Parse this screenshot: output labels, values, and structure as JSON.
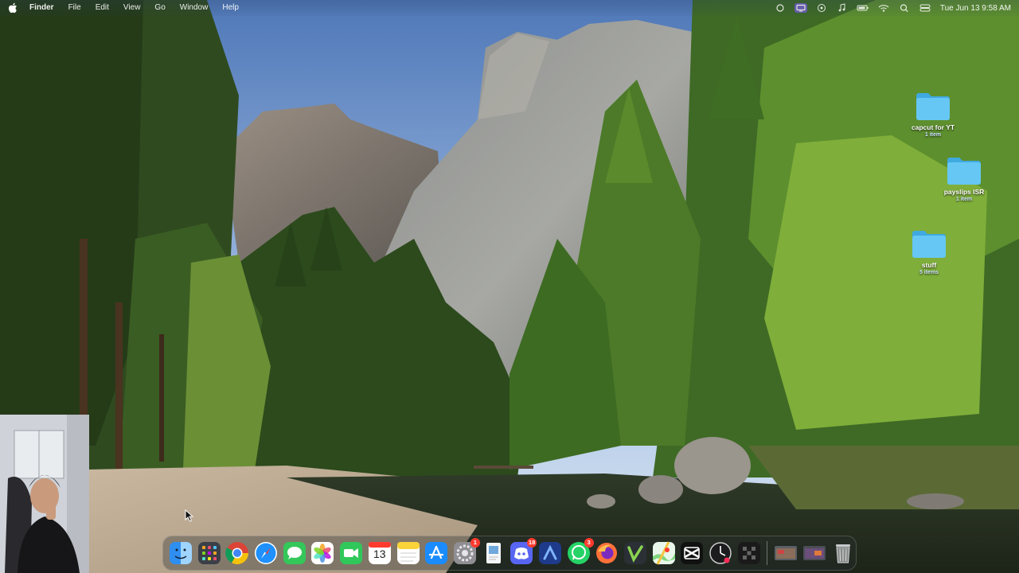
{
  "menubar": {
    "app_name": "Finder",
    "menus": [
      "File",
      "Edit",
      "View",
      "Go",
      "Window",
      "Help"
    ],
    "clock": "Tue Jun 13  9:58 AM",
    "status_icons": [
      "record-icon",
      "screen-mirror-icon",
      "focus-icon",
      "music-icon",
      "battery-icon",
      "wifi-icon",
      "search-icon",
      "control-center-icon"
    ]
  },
  "desktop": {
    "folders": [
      {
        "name": "capcut for YT",
        "count": "1 item"
      },
      {
        "name": "payslips ISR",
        "count": "1 item"
      },
      {
        "name": "stuff",
        "count": "5 items"
      }
    ]
  },
  "dock": {
    "items": [
      {
        "name": "Finder",
        "icon": "finder-icon"
      },
      {
        "name": "Launchpad",
        "icon": "launchpad-icon"
      },
      {
        "name": "Google Chrome",
        "icon": "chrome-icon"
      },
      {
        "name": "Safari",
        "icon": "safari-icon"
      },
      {
        "name": "Messages",
        "icon": "messages-icon"
      },
      {
        "name": "Photos",
        "icon": "photos-icon"
      },
      {
        "name": "FaceTime",
        "icon": "facetime-icon"
      },
      {
        "name": "Calendar",
        "icon": "calendar-icon",
        "day": "13"
      },
      {
        "name": "Notes",
        "icon": "notes-icon"
      },
      {
        "name": "App Store",
        "icon": "app-store-icon"
      },
      {
        "name": "System Settings",
        "icon": "settings-icon",
        "badge": "1"
      },
      {
        "name": "Preview",
        "icon": "preview-icon"
      },
      {
        "name": "Discord",
        "icon": "discord-icon",
        "badge": "18"
      },
      {
        "name": "Arc",
        "icon": "arc-icon"
      },
      {
        "name": "WhatsApp",
        "icon": "whatsapp-icon",
        "badge": "3"
      },
      {
        "name": "Firefox",
        "icon": "firefox-icon"
      },
      {
        "name": "Vectorworks",
        "icon": "v-app-icon"
      },
      {
        "name": "Maps",
        "icon": "maps-icon"
      },
      {
        "name": "CapCut",
        "icon": "capcut-icon"
      },
      {
        "name": "Activity Monitor",
        "icon": "activity-monitor-icon"
      },
      {
        "name": "Game",
        "icon": "game-icon"
      }
    ],
    "recent": [
      "recent-window-icon",
      "recent-window-icon"
    ],
    "trash": {
      "name": "Trash",
      "icon": "trash-icon"
    }
  },
  "colors": {
    "folder": "#5ec3f2",
    "badge": "#ff3b30",
    "sky": "#7ea9d8"
  }
}
